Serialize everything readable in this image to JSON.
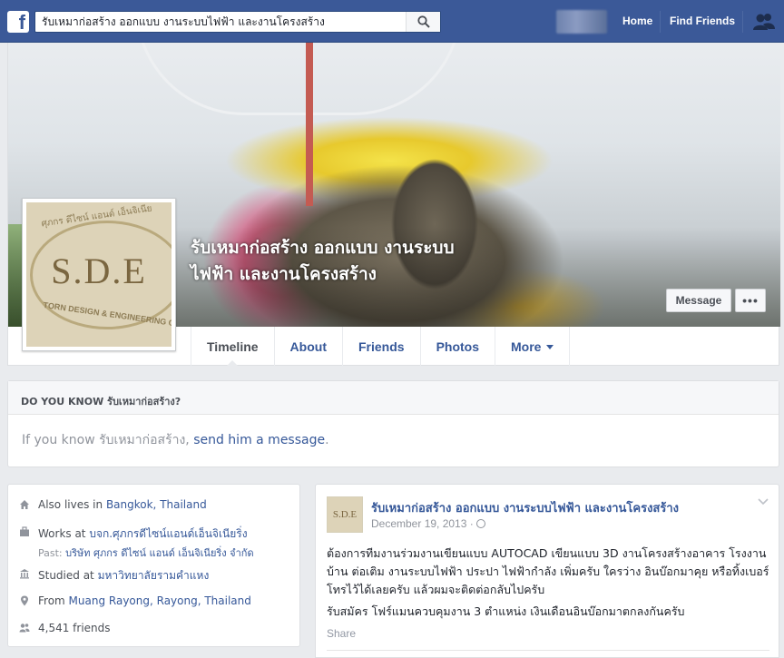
{
  "topbar": {
    "logo": "f",
    "search_value": "รับเหมาก่อสร้าง ออกแบบ งานระบบไฟฟ้า และงานโครงสร้าง",
    "search_icon": "search-icon",
    "home_label": "Home",
    "find_friends_label": "Find Friends",
    "friend_requests_icon": "friend-requests-icon",
    "brand_color": "#3b5998"
  },
  "cover": {
    "title": "รับเหมาก่อสร้าง ออกแบบ งานระบบไฟฟ้า และงานโครงสร้าง",
    "message_button": "Message",
    "more_button": "•••"
  },
  "profile_picture": {
    "main_text": "S.D.E",
    "top_text": "ศุภกร ดีไซน์ แอนด์ เอ็นจิเนีย",
    "bottom_text": "TORN DESIGN & ENGINEERING C"
  },
  "tabs": [
    {
      "label": "Timeline",
      "active": true
    },
    {
      "label": "About"
    },
    {
      "label": "Friends"
    },
    {
      "label": "Photos"
    },
    {
      "label": "More"
    }
  ],
  "know_card": {
    "heading": "DO YOU KNOW รับเหมาก่อสร้าง?",
    "text_before": "If you know รับเหมาก่อสร้าง, ",
    "link": "send him a message",
    "text_after": "."
  },
  "intro": {
    "lives_prefix": "Also lives in ",
    "lives_place": "Bangkok, Thailand",
    "works_prefix": "Works at ",
    "works_place": "บจก.ศุภกรดีไซน์แอนด์เอ็นจิเนียริ่ง",
    "past_prefix": "Past: ",
    "past_place": "บริษัท ศุภกร ดีไซน์ แอนด์ เอ็นจิเนียริ่ง จำกัด",
    "studied_prefix": "Studied at ",
    "studied_place": "มหาวิทยาลัยรามคำแหง",
    "from_prefix": "From ",
    "from_place": "Muang Rayong, Rayong, Thailand",
    "friends_count": "4,541 friends"
  },
  "post": {
    "avatar_text": "S.D.E",
    "author": "รับเหมาก่อสร้าง ออกแบบ งานระบบไฟฟ้า และงานโครงสร้าง",
    "date": "December 19, 2013 ·",
    "paragraph_1": "ต้องการทีมงานร่วมงานเขียนแบบ AUTOCAD เขียนแบบ 3D งานโครงสร้างอาคาร โรงงาน บ้าน ต่อเติม งานระบบไฟฟ้า ประปา ไฟฟ้ากำลัง เพิ่มครับ ใครว่าง อินบ๊อกมาคุย หรือทิ้งเบอร์โทรไว้ได้เลยครับ แล้วผมจะติดต่อกลับไปครับ",
    "paragraph_2": "รับสมัคร โฟร์แมนควบคุมงาน 3 ตำแหน่ง เงินเดือนอินบ๊อกมาตกลงกันครับ",
    "share_label": "Share"
  }
}
